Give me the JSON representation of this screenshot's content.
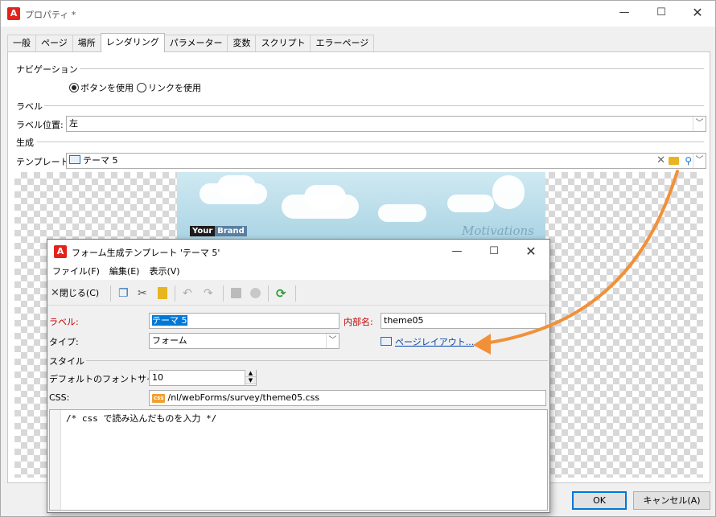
{
  "main_window": {
    "title": "プロパティ *",
    "tabs": [
      "一般",
      "ページ",
      "場所",
      "レンダリング",
      "パラメーター",
      "変数",
      "スクリプト",
      "エラーページ"
    ],
    "active_tab": "レンダリング",
    "navigation": {
      "section": "ナビゲーション",
      "options": [
        "ボタンを使用",
        "リンクを使用"
      ],
      "selected": "ボタンを使用"
    },
    "label_section": {
      "section": "ラベル",
      "position_label": "ラベル位置:",
      "position_value": "左"
    },
    "generation": {
      "section": "生成",
      "template_label": "テンプレート:",
      "template_value": "テーマ 5"
    },
    "preview": {
      "brand_your": "Your",
      "brand_brand": "Brand",
      "tagline": "Motivations"
    },
    "buttons": {
      "ok": "OK",
      "cancel": "キャンセル(A)"
    }
  },
  "child_dialog": {
    "title": "フォーム生成テンプレート 'テーマ 5'",
    "menu": [
      "ファイル(F)",
      "編集(E)",
      "表示(V)"
    ],
    "toolbar": {
      "close_label": "閉じる(C)"
    },
    "form": {
      "label_caption": "ラベル:",
      "label_value": "テーマ 5",
      "internal_name_caption": "内部名:",
      "internal_name_value": "theme05",
      "type_caption": "タイプ:",
      "type_value": "フォーム",
      "page_layout_link": "ページレイアウト...",
      "style_section": "スタイル",
      "font_size_caption": "デフォルトのフォントサイズ:",
      "font_size_value": "10",
      "css_caption": "CSS:",
      "css_badge": "css",
      "css_value": "/nl/webForms/survey/theme05.css",
      "editor_text": "/* css で読み込んだものを入力 */"
    }
  },
  "colors": {
    "accent_blue": "#0078d7",
    "required_red": "#c00000",
    "arrow_orange": "#f0913a",
    "app_icon_red": "#e2231a"
  }
}
